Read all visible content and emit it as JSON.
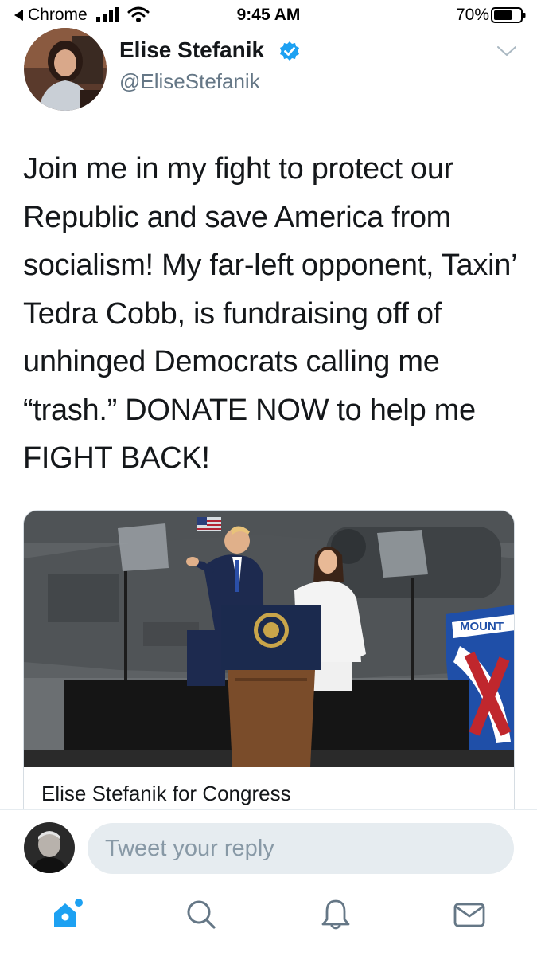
{
  "status_bar": {
    "back_app": "Chrome",
    "time": "9:45 AM",
    "battery": "70%",
    "battery_level": 0.7
  },
  "tweet": {
    "author_name": "Elise Stefanik",
    "author_handle": "@EliseStefanik",
    "verified": true,
    "text": "Join me in my fight to protect our Republic and save America from socialism! My far-left opponent, Taxin’ Tedra Cobb, is fundraising off of unhinged Democrats calling me “trash.” DONATE NOW to help me FIGHT BACK!",
    "card": {
      "title": "Elise Stefanik for Congress",
      "badge_text": "MOUNT"
    }
  },
  "reply": {
    "placeholder": "Tweet your reply"
  },
  "tab_bar": {
    "items": [
      {
        "icon": "home-icon",
        "active": true
      },
      {
        "icon": "search-icon",
        "active": false
      },
      {
        "icon": "notifications-icon",
        "active": false
      },
      {
        "icon": "messages-icon",
        "active": false
      }
    ]
  },
  "colors": {
    "twitter_blue": "#1da1f2",
    "handle_gray": "#657786",
    "icon_gray": "#657786",
    "reply_bg": "#e6ecf0"
  }
}
